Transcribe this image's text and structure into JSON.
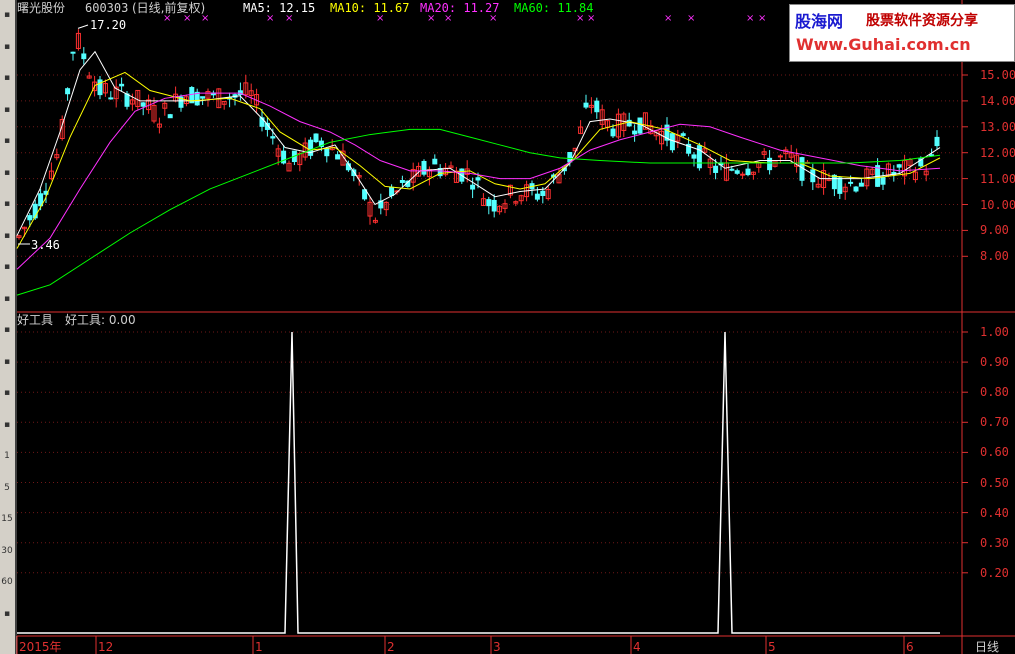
{
  "header": {
    "stock_name": "曙光股份",
    "stock_code": "600303",
    "period": "(日线,前复权)",
    "ma5": "MA5: 12.15",
    "ma10": "MA10: 11.67",
    "ma20": "MA20: 11.27",
    "ma60": "MA60: 11.84"
  },
  "price_labels": {
    "high": "17.20",
    "low": "3.46"
  },
  "indicator": {
    "title": "好工具",
    "value_label": "好工具: 0.00"
  },
  "upper_axis": [
    "15.00",
    "14.00",
    "13.00",
    "12.00",
    "11.00",
    "10.00",
    "9.00",
    "8.00"
  ],
  "lower_axis": [
    "1.00",
    "0.90",
    "0.80",
    "0.70",
    "0.60",
    "0.50",
    "0.40",
    "0.30",
    "0.20"
  ],
  "xaxis": {
    "labels": [
      "2015年",
      "12",
      "1",
      "2",
      "3",
      "4",
      "5",
      "6"
    ],
    "period_label": "日线"
  },
  "watermark": {
    "brand": "股海网",
    "slogan": "股票软件资源分享",
    "url": "Www.Guhai.com.cn"
  },
  "toolbar_icons": [
    "chart-icon",
    "bar-icon",
    "grid-icon",
    "line-icon",
    "table-icon",
    "f10-icon",
    "bag-icon",
    "person-icon",
    "rsi-icon",
    "gear-icon",
    "move-icon",
    "pencil-icon",
    "f5-icon",
    "export-icon",
    "1",
    "5",
    "15",
    "30",
    "60",
    "month-icon"
  ],
  "colors": {
    "up": "#ff3030",
    "down": "#54ffff",
    "ma5": "#ffffff",
    "ma10": "#ffff00",
    "ma20": "#ff30ff",
    "ma60": "#00ff00",
    "axis": "#e03030"
  },
  "chart_data": [
    {
      "type": "candlestick",
      "title": "曙光股份 600303 (日线,前复权)",
      "ylim": [
        7.0,
        17.5
      ],
      "series": [
        {
          "name": "MA5",
          "color": "#ffffff"
        },
        {
          "name": "MA10",
          "color": "#ffff00"
        },
        {
          "name": "MA20",
          "color": "#ff30ff"
        },
        {
          "name": "MA60",
          "color": "#00ff00"
        }
      ],
      "annotations": [
        {
          "label": "17.20"
        },
        {
          "label": "3.46"
        }
      ],
      "x_labels": [
        "2015年",
        "12",
        "1",
        "2",
        "3",
        "4",
        "5",
        "6"
      ]
    },
    {
      "type": "line",
      "title": "好工具",
      "ylim": [
        0,
        1.05
      ],
      "description_values": {
        "baseline": 0.0,
        "peaks": [
          {
            "x_month_between": "12-1",
            "value": 1.0
          },
          {
            "x_month_between": "4-5",
            "value": 1.0
          }
        ]
      },
      "yticks": [
        1.0,
        0.9,
        0.8,
        0.7,
        0.6,
        0.5,
        0.4,
        0.3,
        0.2
      ]
    }
  ]
}
